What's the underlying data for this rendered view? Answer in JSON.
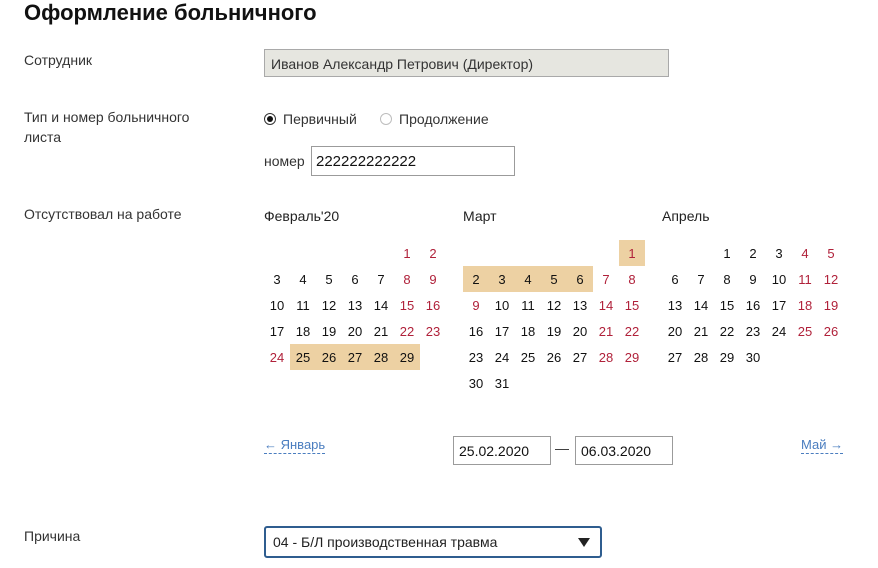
{
  "page_title": "Оформление больничного",
  "employee": {
    "label": "Сотрудник",
    "value": "Иванов Александр Петрович (Директор)"
  },
  "sick_type": {
    "label": "Тип и номер больничного листа",
    "options": [
      {
        "label": "Первичный",
        "selected": true
      },
      {
        "label": "Продолжение",
        "selected": false
      }
    ],
    "number_label": "номер",
    "number_value": "222222222222"
  },
  "absence": {
    "label": "Отсутствовал на работе",
    "months": [
      {
        "name": "Февраль'20",
        "first_weekday": 5,
        "days": 29,
        "weekend": [
          1,
          2,
          8,
          9,
          15,
          16,
          22,
          23,
          24
        ],
        "selected": [
          25,
          26,
          27,
          28,
          29
        ]
      },
      {
        "name": "Март",
        "first_weekday": 6,
        "days": 31,
        "weekend": [
          1,
          7,
          8,
          9,
          14,
          15,
          21,
          22,
          28,
          29
        ],
        "selected": [
          1,
          2,
          3,
          4,
          5,
          6
        ]
      },
      {
        "name": "Апрель",
        "first_weekday": 2,
        "days": 30,
        "weekend": [
          4,
          5,
          11,
          12,
          18,
          19,
          25,
          26
        ],
        "selected": []
      }
    ],
    "prev_link": "← Январь",
    "next_link": "Май →",
    "date_from": "25.02.2020",
    "date_separator": "—",
    "date_to": "06.03.2020"
  },
  "reason": {
    "label": "Причина",
    "value": "04 - Б/Л производственная травма"
  },
  "colors": {
    "selected_day": "#edd1a3",
    "weekend_day": "#b0213a",
    "link": "#4a7dbf",
    "select_border": "#2f5d8f"
  }
}
